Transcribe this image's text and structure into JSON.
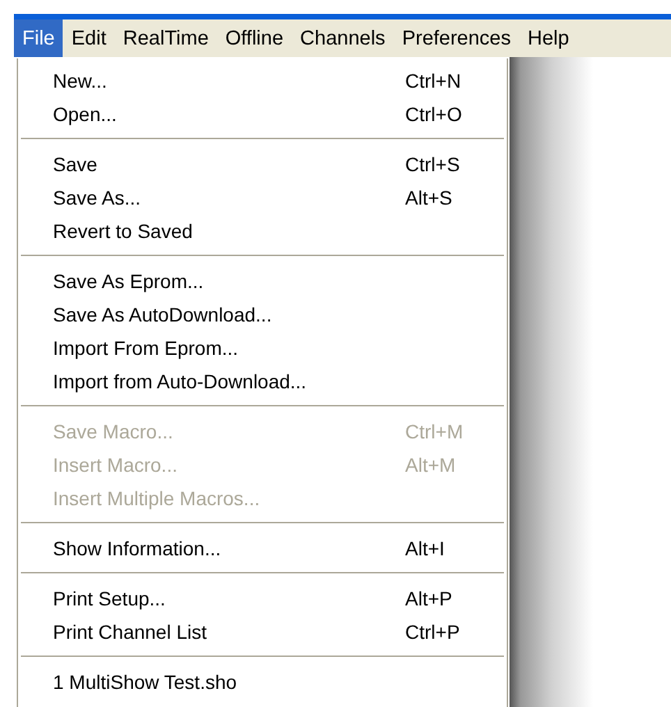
{
  "menubar": [
    {
      "label": "File",
      "selected": true
    },
    {
      "label": "Edit",
      "selected": false
    },
    {
      "label": "RealTime",
      "selected": false
    },
    {
      "label": "Offline",
      "selected": false
    },
    {
      "label": "Channels",
      "selected": false
    },
    {
      "label": "Preferences",
      "selected": false
    },
    {
      "label": "Help",
      "selected": false
    }
  ],
  "file_menu": {
    "groups": [
      [
        {
          "label": "New...",
          "shortcut": "Ctrl+N",
          "disabled": false
        },
        {
          "label": "Open...",
          "shortcut": "Ctrl+O",
          "disabled": false
        }
      ],
      [
        {
          "label": "Save",
          "shortcut": "Ctrl+S",
          "disabled": false
        },
        {
          "label": "Save As...",
          "shortcut": "Alt+S",
          "disabled": false
        },
        {
          "label": "Revert to Saved",
          "disabled": false
        }
      ],
      [
        {
          "label": "Save As Eprom...",
          "disabled": false
        },
        {
          "label": "Save As AutoDownload...",
          "disabled": false
        },
        {
          "label": "Import From Eprom...",
          "disabled": false
        },
        {
          "label": "Import from Auto-Download...",
          "disabled": false
        }
      ],
      [
        {
          "label": "Save Macro...",
          "shortcut": "Ctrl+M",
          "disabled": true
        },
        {
          "label": "Insert Macro...",
          "shortcut": "Alt+M",
          "disabled": true
        },
        {
          "label": "Insert Multiple Macros...",
          "disabled": true
        }
      ],
      [
        {
          "label": "Show Information...",
          "shortcut": "Alt+I",
          "disabled": false
        }
      ],
      [
        {
          "label": "Print Setup...",
          "shortcut": "Alt+P",
          "disabled": false
        },
        {
          "label": "Print Channel List",
          "shortcut": "Ctrl+P",
          "disabled": false
        }
      ],
      [
        {
          "label": "1 MultiShow Test.sho",
          "disabled": false
        }
      ]
    ]
  }
}
